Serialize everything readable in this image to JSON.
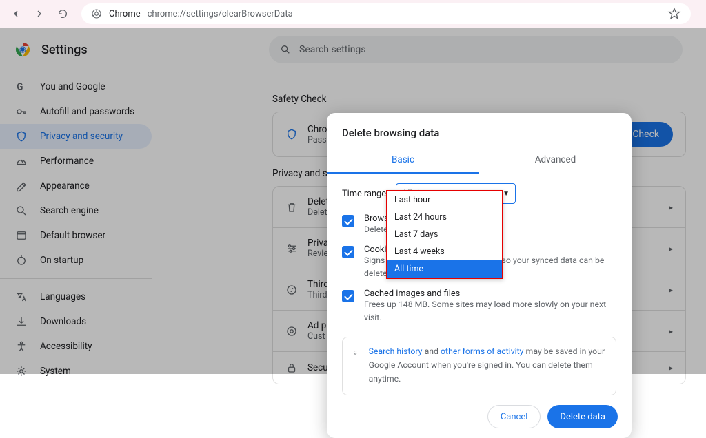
{
  "browser": {
    "url_prefix": "chrome://",
    "url_rest": "settings/clearBrowserData",
    "site_label": "Chrome"
  },
  "header": {
    "title": "Settings",
    "search_placeholder": "Search settings"
  },
  "sidebar": {
    "items": [
      {
        "label": "You and Google"
      },
      {
        "label": "Autofill and passwords"
      },
      {
        "label": "Privacy and security"
      },
      {
        "label": "Performance"
      },
      {
        "label": "Appearance"
      },
      {
        "label": "Search engine"
      },
      {
        "label": "Default browser"
      },
      {
        "label": "On startup"
      },
      {
        "label": "Languages"
      },
      {
        "label": "Downloads"
      },
      {
        "label": "Accessibility"
      },
      {
        "label": "System"
      }
    ]
  },
  "content": {
    "safety_label": "Safety Check",
    "safety_card_title": "Chro",
    "safety_card_sub": "Passw",
    "safety_button": "ty Check",
    "privacy_label": "Privacy and s",
    "rows": [
      {
        "title": "Delet",
        "sub": "Delet"
      },
      {
        "title": "Priva",
        "sub": "Revie"
      },
      {
        "title": "Third",
        "sub": "Third"
      },
      {
        "title": "Ad p",
        "sub": "Cust"
      },
      {
        "title": "Secu",
        "sub": ""
      }
    ]
  },
  "dialog": {
    "title": "Delete browsing data",
    "tabs": {
      "basic": "Basic",
      "advanced": "Advanced"
    },
    "time_label": "Time range",
    "time_value": "All time",
    "options": [
      {
        "label": "Brows",
        "sub": "Delete"
      },
      {
        "label": "Cookie",
        "sub": "Signs yed in to your Google Account so your synced data can be deleted."
      },
      {
        "label": "Cached images and files",
        "sub": "Frees up 148 MB. Some sites may load more slowly on your next visit."
      }
    ],
    "info": {
      "link1": "Search history",
      "mid": " and ",
      "link2": "other forms of activity",
      "rest": " may be saved in your Google Account when you're signed in. You can delete them anytime."
    },
    "cancel": "Cancel",
    "confirm": "Delete data"
  },
  "dropdown": {
    "items": [
      "Last hour",
      "Last 24 hours",
      "Last 7 days",
      "Last 4 weeks",
      "All time"
    ],
    "selected": "All time"
  }
}
